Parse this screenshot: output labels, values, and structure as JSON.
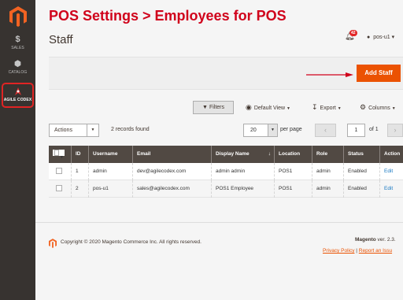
{
  "annotation_title": "POS Settings > Employees for POS",
  "sidebar": {
    "items": [
      {
        "label": "SALES",
        "icon": "$"
      },
      {
        "label": "CATALOG",
        "icon": "⬢"
      },
      {
        "label": "AGILE CODEX",
        "icon": "agile-codex-icon"
      }
    ]
  },
  "header": {
    "page_title": "Staff",
    "notifications_count": "42",
    "user_name": "pos-u1"
  },
  "actions": {
    "add_staff_label": "Add Staff"
  },
  "toolbar": {
    "filters_label": "Filters",
    "default_view_label": "Default View",
    "export_label": "Export",
    "columns_label": "Columns"
  },
  "grid_controls": {
    "actions_label": "Actions",
    "records_found": "2 records found",
    "per_page_value": "20",
    "per_page_label": "per page",
    "current_page": "1",
    "page_of": "of 1"
  },
  "table": {
    "columns": [
      "ID",
      "Username",
      "Email",
      "Display Name",
      "Location",
      "Role",
      "Status",
      "Action"
    ],
    "rows": [
      {
        "id": "1",
        "username": "admin",
        "email": "dev@agilecodex.com",
        "display_name": "admin admin",
        "location": "POS1",
        "role": "admin",
        "status": "Enabled",
        "action": "Edit"
      },
      {
        "id": "2",
        "username": "pos-u1",
        "email": "sales@agilecodex.com",
        "display_name": "POS1 Employee",
        "location": "POS1",
        "role": "admin",
        "status": "Enabled",
        "action": "Edit"
      }
    ]
  },
  "footer": {
    "copyright": "Copyright © 2020 Magento Commerce Inc. All rights reserved.",
    "version_brand": "Magento",
    "version_text": " ver. 2.3.",
    "privacy_policy": "Privacy Policy",
    "separator": " | ",
    "report_issue": "Report an Issu"
  },
  "colors": {
    "sidebar_bg": "#373330",
    "accent_orange": "#eb5202",
    "annotation_red": "#d0021b",
    "grid_header": "#514943",
    "link_blue": "#1979c3"
  }
}
